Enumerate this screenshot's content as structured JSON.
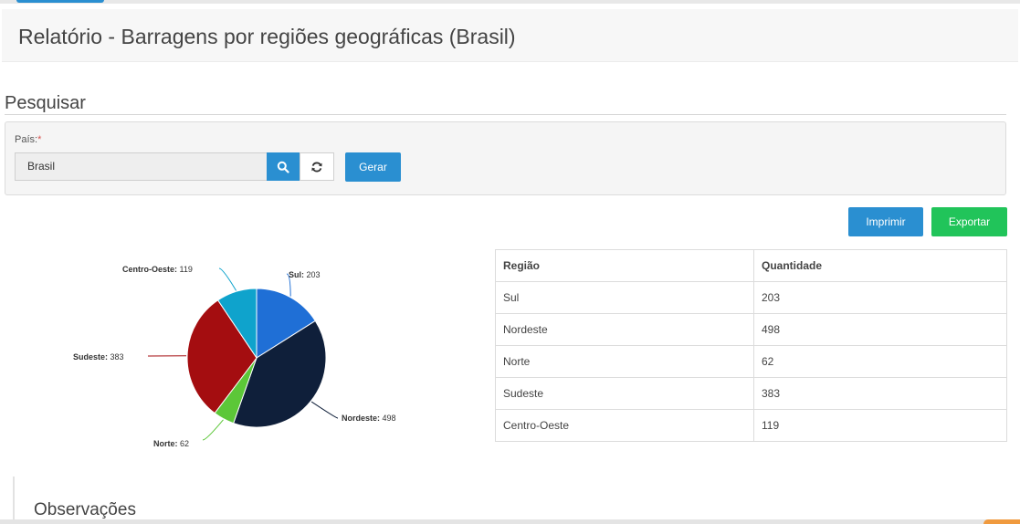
{
  "page": {
    "title": "Relatório - Barragens por regiões geográficas (Brasil)"
  },
  "search": {
    "heading": "Pesquisar",
    "country_label": "País:",
    "required_mark": "*",
    "country_value": "Brasil",
    "search_icon": "search-icon",
    "reset_icon": "refresh-icon",
    "generate_label": "Gerar"
  },
  "actions": {
    "print_label": "Imprimir",
    "export_label": "Exportar"
  },
  "chart_data": {
    "type": "pie",
    "title": "",
    "categories": [
      "Sul",
      "Nordeste",
      "Norte",
      "Sudeste",
      "Centro-Oeste"
    ],
    "values": [
      203,
      498,
      62,
      383,
      119
    ],
    "colors": [
      "#1f6fd6",
      "#0f1f3a",
      "#5cc738",
      "#a40d10",
      "#0fa3cc"
    ]
  },
  "table": {
    "headers": [
      "Região",
      "Quantidade"
    ],
    "rows": [
      [
        "Sul",
        "203"
      ],
      [
        "Nordeste",
        "498"
      ],
      [
        "Norte",
        "62"
      ],
      [
        "Sudeste",
        "383"
      ],
      [
        "Centro-Oeste",
        "119"
      ]
    ]
  },
  "observations": {
    "heading": "Observações"
  }
}
